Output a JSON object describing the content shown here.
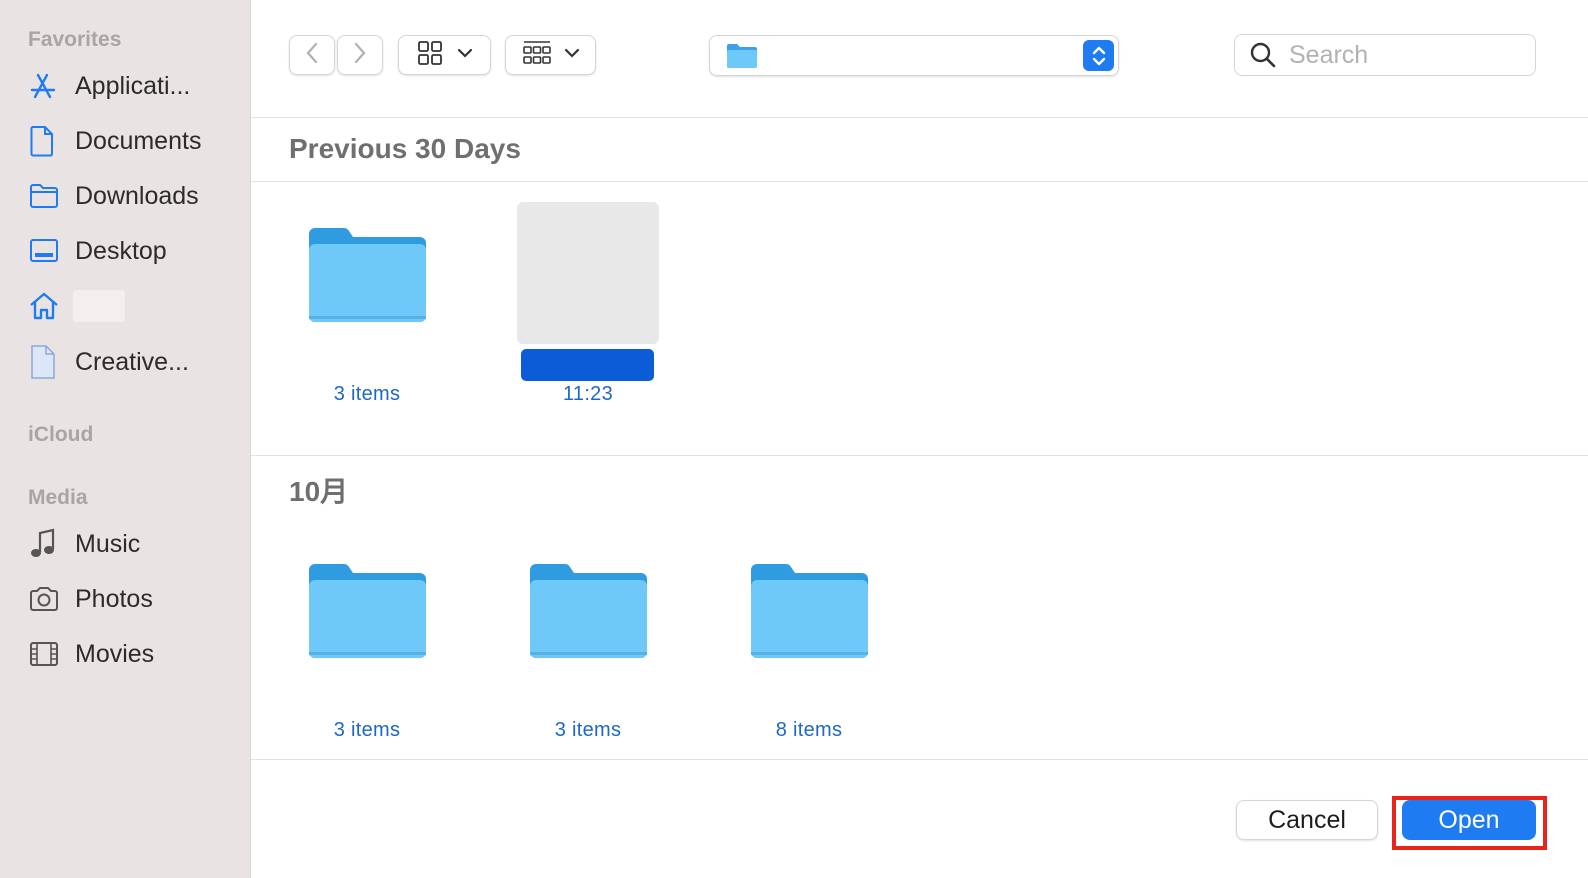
{
  "sidebar": {
    "favorites_title": "Favorites",
    "icloud_title": "iCloud",
    "media_title": "Media",
    "favorites": [
      {
        "label": "Applicati...",
        "icon": "applications-icon"
      },
      {
        "label": "Documents",
        "icon": "document-icon"
      },
      {
        "label": "Downloads",
        "icon": "folder-icon"
      },
      {
        "label": "Desktop",
        "icon": "desktop-icon"
      },
      {
        "label": "",
        "icon": "home-icon"
      },
      {
        "label": "Creative...",
        "icon": "document-icon"
      }
    ],
    "media": [
      {
        "label": "Music",
        "icon": "music-note-icon"
      },
      {
        "label": "Photos",
        "icon": "camera-icon"
      },
      {
        "label": "Movies",
        "icon": "film-icon"
      }
    ]
  },
  "toolbar": {
    "search_placeholder": "Search"
  },
  "groups": [
    {
      "title": "Previous 30 Days",
      "items": [
        {
          "type": "folder",
          "subtitle": "3 items"
        },
        {
          "type": "file-selected",
          "subtitle": "11:23"
        }
      ]
    },
    {
      "title": "10月",
      "items": [
        {
          "type": "folder",
          "subtitle": "3 items"
        },
        {
          "type": "folder",
          "subtitle": "3 items"
        },
        {
          "type": "folder",
          "subtitle": "8 items"
        }
      ]
    }
  ],
  "footer": {
    "cancel_label": "Cancel",
    "open_label": "Open"
  },
  "colors": {
    "accent": "#1f7bf2",
    "sidebar_bg": "#e9e4e3",
    "folder": "#6ec8f8",
    "highlight_border": "#e8241b"
  }
}
